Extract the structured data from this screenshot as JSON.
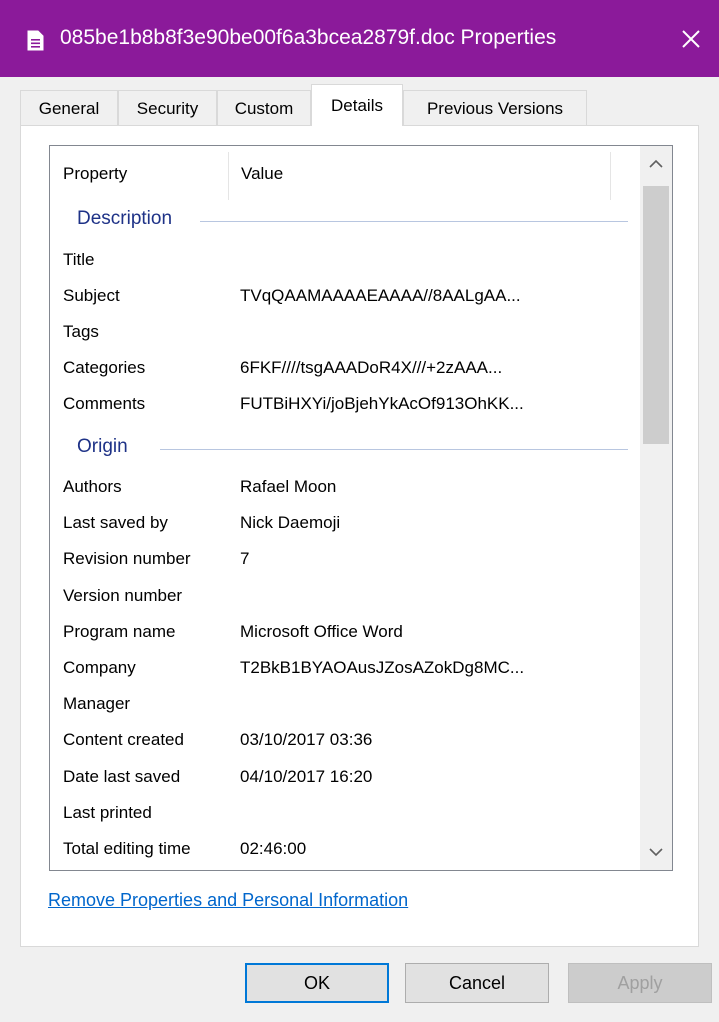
{
  "window": {
    "title": "085be1b8b8f3e90be00f6a3bcea2879f.doc Properties",
    "titlebar_color": "#8b1a9a"
  },
  "tabs": [
    {
      "label": "General",
      "active": false
    },
    {
      "label": "Security",
      "active": false
    },
    {
      "label": "Custom",
      "active": false
    },
    {
      "label": "Details",
      "active": true
    },
    {
      "label": "Previous Versions",
      "active": false
    }
  ],
  "columns": {
    "property": "Property",
    "value": "Value"
  },
  "groups": {
    "description": "Description",
    "origin": "Origin"
  },
  "description_rows": [
    {
      "key": "Title",
      "value": ""
    },
    {
      "key": "Subject",
      "value": "TVqQAAMAAAAEAAAA//8AALgAA..."
    },
    {
      "key": "Tags",
      "value": ""
    },
    {
      "key": "Categories",
      "value": "6FKF////tsgAAADoR4X///+2zAAA..."
    },
    {
      "key": "Comments",
      "value": "FUTBiHXYi/joBjehYkAcOf913OhKK..."
    }
  ],
  "origin_rows": [
    {
      "key": "Authors",
      "value": "Rafael Moon"
    },
    {
      "key": "Last saved by",
      "value": "Nick Daemoji"
    },
    {
      "key": "Revision number",
      "value": "7"
    },
    {
      "key": "Version number",
      "value": ""
    },
    {
      "key": "Program name",
      "value": "Microsoft Office Word"
    },
    {
      "key": "Company",
      "value": "T2BkB1BYAOAusJZosAZokDg8MC..."
    },
    {
      "key": "Manager",
      "value": ""
    },
    {
      "key": "Content created",
      "value": "03/10/2017 03:36"
    },
    {
      "key": "Date last saved",
      "value": "04/10/2017 16:20"
    },
    {
      "key": "Last printed",
      "value": ""
    },
    {
      "key": "Total editing time",
      "value": "02:46:00"
    }
  ],
  "link": {
    "remove_label": "Remove Properties and Personal Information"
  },
  "buttons": {
    "ok": "OK",
    "cancel": "Cancel",
    "apply": "Apply"
  }
}
